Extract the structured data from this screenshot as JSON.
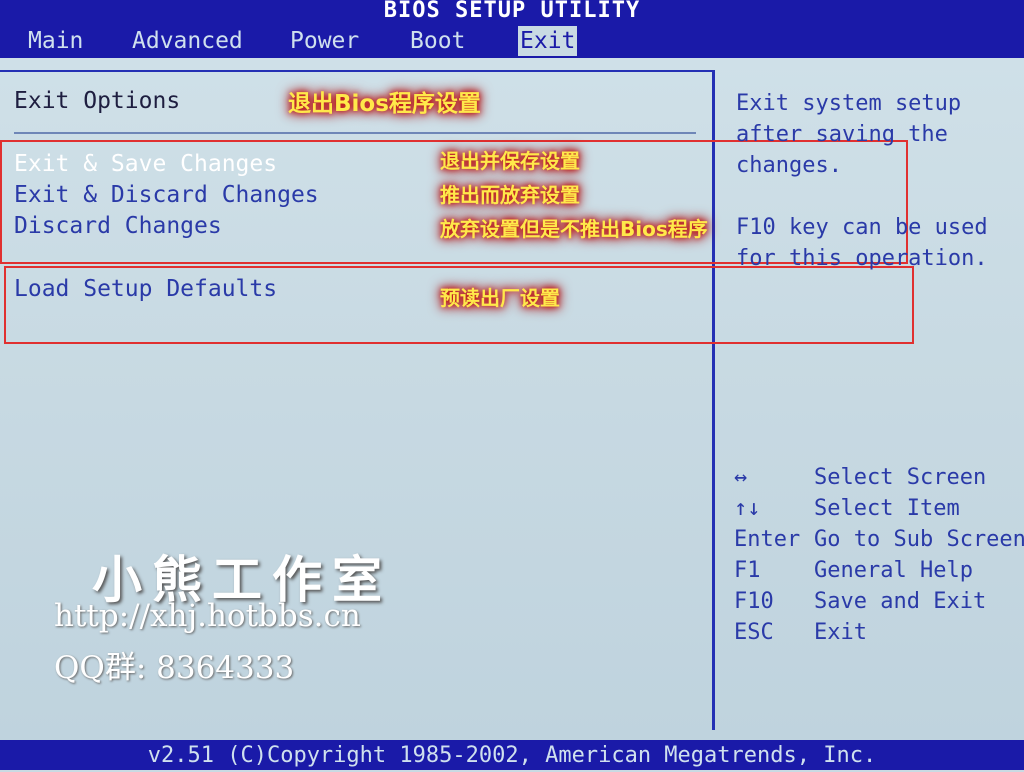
{
  "title_bar": {
    "title": "BIOS SETUP UTILITY"
  },
  "menu": {
    "tabs": [
      {
        "label": "Main"
      },
      {
        "label": "Advanced"
      },
      {
        "label": "Power"
      },
      {
        "label": "Boot"
      },
      {
        "label": "Exit"
      }
    ],
    "active": "Exit"
  },
  "main": {
    "section_title": "Exit Options",
    "section_title_annotation": "退出Bios程序设置",
    "options": [
      {
        "label": "Exit & Save Changes",
        "annotation": "退出并保存设置",
        "selected": true
      },
      {
        "label": "Exit & Discard Changes",
        "annotation": "推出而放弃设置",
        "selected": false
      },
      {
        "label": "Discard Changes",
        "annotation": "放弃设置但是不推出Bios程序",
        "selected": false
      },
      {
        "label": "Load Setup Defaults",
        "annotation": "预读出厂设置",
        "selected": false
      }
    ]
  },
  "help": {
    "text": "Exit system setup\nafter saving the\nchanges.\n\nF10 key can be used\nfor this operation."
  },
  "keys": [
    {
      "key": "↔",
      "desc": "Select Screen"
    },
    {
      "key": "↑↓",
      "desc": "Select Item"
    },
    {
      "key": "Enter",
      "desc": "Go to Sub Screen"
    },
    {
      "key": "F1",
      "desc": "General Help"
    },
    {
      "key": "F10",
      "desc": "Save and Exit"
    },
    {
      "key": "ESC",
      "desc": "Exit"
    }
  ],
  "footer": {
    "text": "v2.51 (C)Copyright 1985-2002, American Megatrends, Inc."
  },
  "watermark": {
    "studio": "小熊工作室",
    "url": "http://xhj.hotbbs.cn",
    "qq": "QQ群: 8364333"
  },
  "colors": {
    "bar_blue": "#1a1aa8",
    "panel_bg": "#c9dae3",
    "text_blue": "#2a3aa8",
    "highlight": "#ffffff",
    "annotation_yellow": "#ffe94a",
    "annotation_red_box": "#e03030"
  }
}
